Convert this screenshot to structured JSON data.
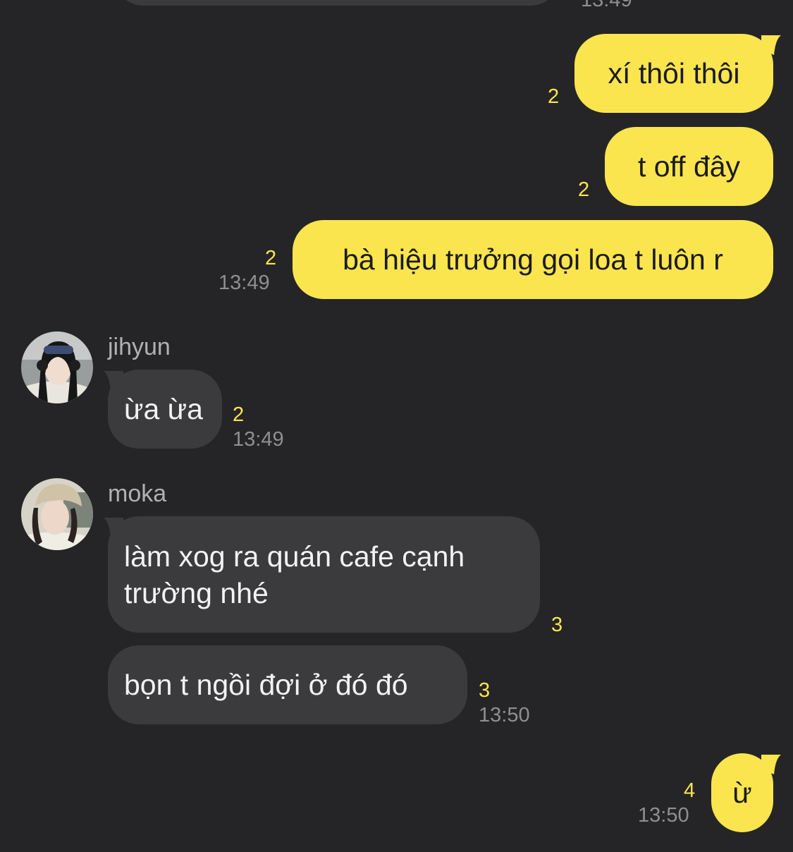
{
  "top_partial": {
    "time": "13:49"
  },
  "messages_out_1": [
    {
      "text": "xí thôi thôi",
      "read_count": "2"
    },
    {
      "text": "t off đây",
      "read_count": "2"
    },
    {
      "text": "bà hiệu trưởng gọi loa t luôn r",
      "read_count": "2",
      "time": "13:49"
    }
  ],
  "jihyun": {
    "name": "jihyun",
    "messages": [
      {
        "text": "ừa ừa",
        "read_count": "2",
        "time": "13:49"
      }
    ]
  },
  "moka": {
    "name": "moka",
    "messages": [
      {
        "text_line1": "làm xog ra quán cafe cạnh",
        "text_line2": "trường nhé",
        "read_count": "3"
      },
      {
        "text": "bọn t ngồi đợi ở đó đó",
        "read_count": "3",
        "time": "13:50"
      }
    ]
  },
  "messages_out_2": [
    {
      "text": "ừ",
      "read_count": "4",
      "time": "13:50"
    }
  ],
  "colors": {
    "background": "#252527",
    "my_bubble": "#fae54f",
    "their_bubble": "#3b3b3d",
    "read_count": "#fae54f",
    "timestamp": "#8f8f91"
  }
}
